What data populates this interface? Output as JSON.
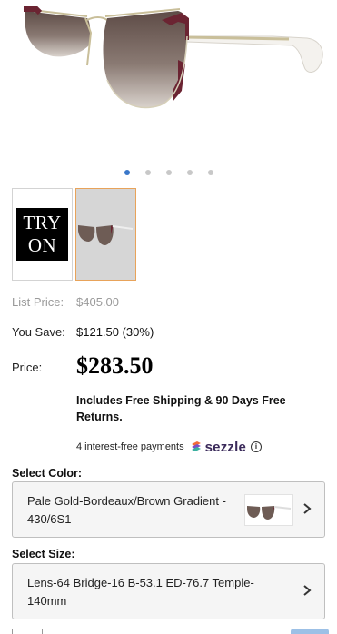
{
  "product": {
    "try_on": {
      "line1": "TRY",
      "line2": "ON"
    },
    "carousel": {
      "count": 5,
      "active_index": 0
    }
  },
  "pricing": {
    "list_label": "List Price:",
    "list_value": "$405.00",
    "save_label": "You Save:",
    "save_value": "$121.50 (30%)",
    "price_label": "Price:",
    "price_value": "$283.50",
    "shipping_note": "Includes Free Shipping & 90 Days Free Returns."
  },
  "sezzle": {
    "text": "4 interest-free payments",
    "brand": "sezzle",
    "info": "i"
  },
  "color": {
    "label": "Select Color:",
    "value": "Pale Gold-Bordeaux/Brown Gradient - 430/6S1"
  },
  "size": {
    "label": "Select Size:",
    "value": "Lens-64 Bridge-16 B-53.1 ED-76.7 Temple-140mm"
  },
  "colors": {
    "accent": "#3a77c9",
    "thumb_selected_border": "#e8a35a",
    "frame_bordeaux": "#6b2432",
    "lens_brown": "#7a6a64"
  }
}
